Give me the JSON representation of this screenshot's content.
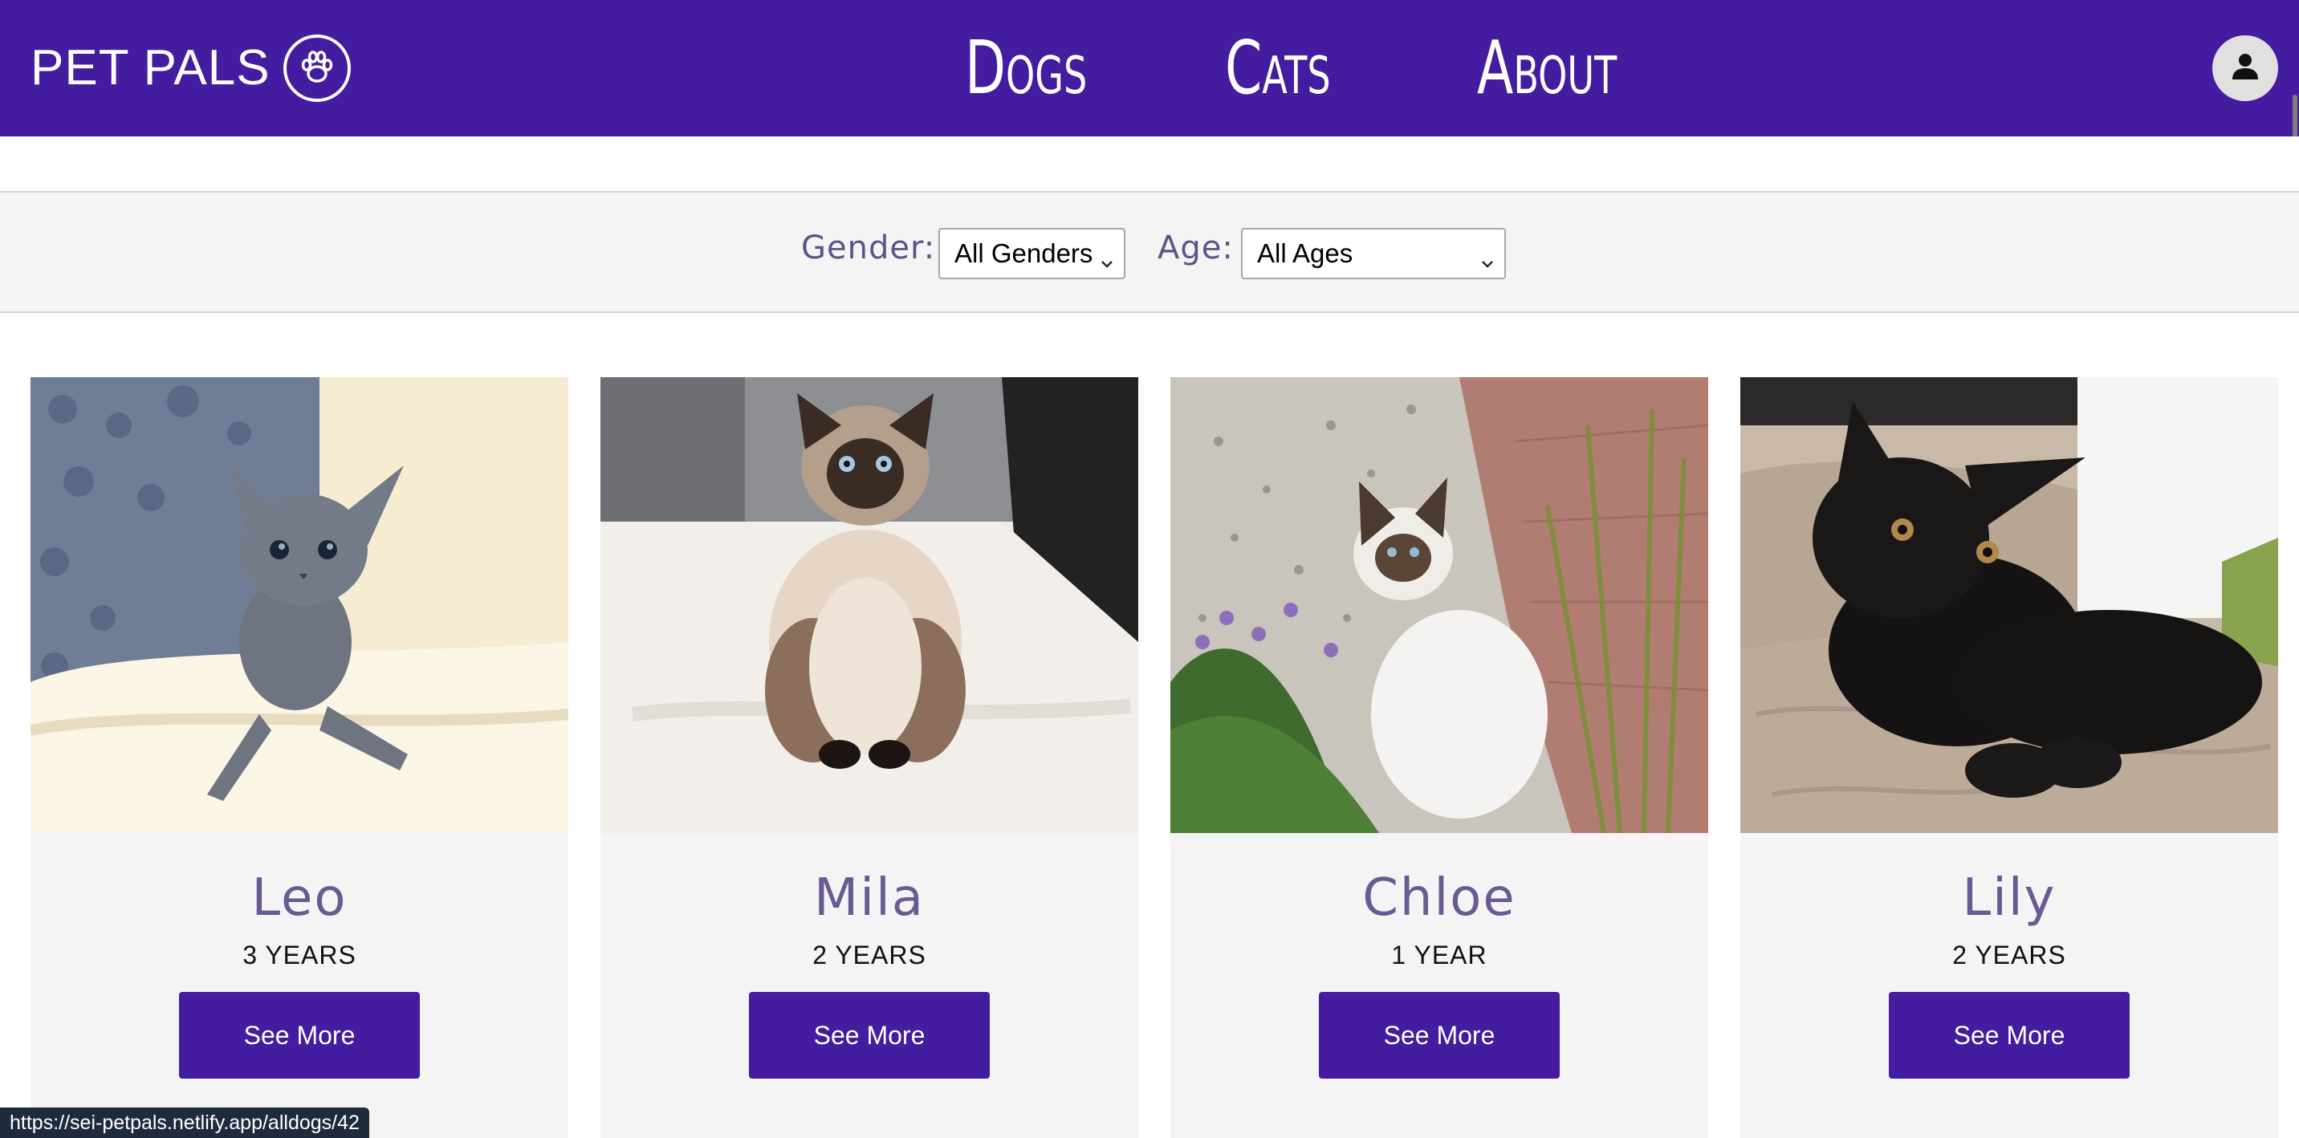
{
  "header": {
    "brand": "PET PALS",
    "nav": [
      {
        "label": "Dogs"
      },
      {
        "label": "Cats"
      },
      {
        "label": "About"
      }
    ]
  },
  "filters": {
    "gender_label": "Gender:",
    "gender_value": "All Genders",
    "age_label": "Age:",
    "age_value": "All Ages"
  },
  "pets": [
    {
      "name": "Leo",
      "age": "3 YEARS",
      "button": "See More",
      "photo": "grey-kitten-on-blanket"
    },
    {
      "name": "Mila",
      "age": "2 YEARS",
      "button": "See More",
      "photo": "himalayan-cat-sitting"
    },
    {
      "name": "Chloe",
      "age": "1 YEAR",
      "button": "See More",
      "photo": "birman-cat-in-garden"
    },
    {
      "name": "Lily",
      "age": "2 YEARS",
      "button": "See More",
      "photo": "black-persian-kitten"
    }
  ],
  "status_bar": {
    "url": "https://sei-petpals.netlify.app/alldogs/42"
  },
  "colors": {
    "brand": "#431c9f",
    "accent_text": "#6a5a93",
    "card_bg": "#f4f4f4"
  },
  "icons": {
    "brand_icon": "paw-icon",
    "account_icon": "user-icon",
    "select_icon": "chevron-down-icon"
  }
}
